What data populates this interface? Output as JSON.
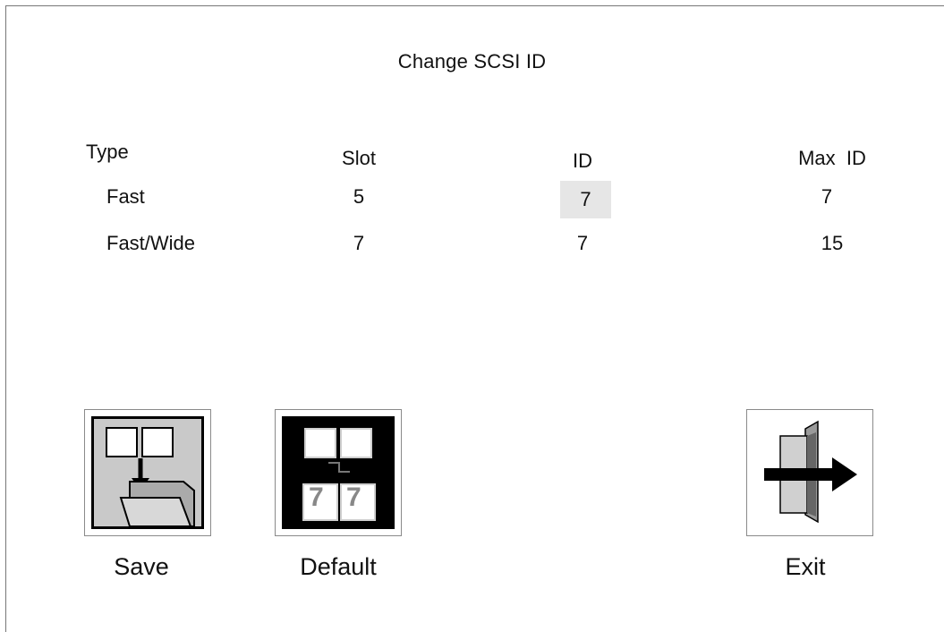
{
  "screen": {
    "title": "Change SCSI ID"
  },
  "table": {
    "headers": {
      "type": "Type",
      "slot": "Slot",
      "id": "ID",
      "max_id": "Max  ID"
    },
    "rows": [
      {
        "type": "Fast",
        "slot": "5",
        "id": "7",
        "max_id": "7",
        "id_selected": true
      },
      {
        "type": "Fast/Wide",
        "slot": "7",
        "id": "7",
        "max_id": "15",
        "id_selected": false
      }
    ]
  },
  "buttons": {
    "save": {
      "label": "Save",
      "icon": "save-folder-icon"
    },
    "default": {
      "label": "Default",
      "icon": "default-ids-icon"
    },
    "exit": {
      "label": "Exit",
      "icon": "exit-door-icon"
    }
  },
  "colors": {
    "selected_cell_bg": "#e6e6e6",
    "button_border": "#8a8a8a",
    "default_icon_bg": "#000000"
  }
}
